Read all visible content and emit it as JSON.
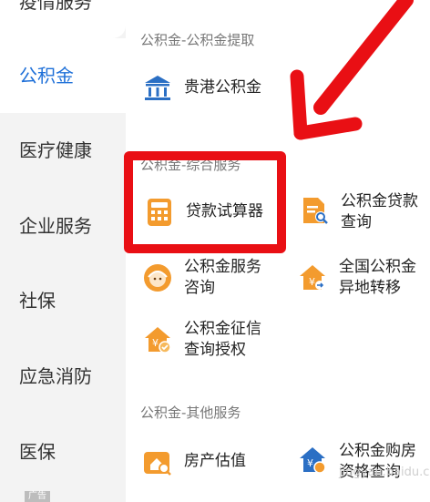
{
  "sidebar": {
    "items": [
      {
        "label": "疫情服务"
      },
      {
        "label": "公积金"
      },
      {
        "label": "医疗健康"
      },
      {
        "label": "企业服务"
      },
      {
        "label": "社保"
      },
      {
        "label": "应急消防"
      },
      {
        "label": "医保"
      }
    ],
    "active_index": 1,
    "active_color": "#1d6fd8"
  },
  "sections": [
    {
      "title": "公积金-公积金提取",
      "tiles": [
        {
          "label": "贵港公积金",
          "icon": "bank-icon"
        }
      ]
    },
    {
      "title": "公积金-综合服务",
      "tiles": [
        {
          "label": "贷款试算器",
          "icon": "calculator-icon"
        },
        {
          "label": "公积金贷款查询",
          "icon": "document-search-icon"
        },
        {
          "label": "公积金服务咨询",
          "icon": "customer-service-icon"
        },
        {
          "label": "全国公积金异地转移",
          "icon": "house-transfer-icon"
        },
        {
          "label": "公积金征信查询授权",
          "icon": "house-check-icon"
        }
      ]
    },
    {
      "title": "公积金-其他服务",
      "tiles": [
        {
          "label": "房产估值",
          "icon": "house-search-icon"
        },
        {
          "label": "公积金购房资格查询",
          "icon": "house-person-icon"
        }
      ]
    }
  ],
  "ad_tag": "广告",
  "watermark": "jingyan.baidu.com",
  "colors": {
    "highlight_red": "#e90f14",
    "icon_orange": "#f39b2e",
    "icon_blue": "#2b6fc4"
  }
}
